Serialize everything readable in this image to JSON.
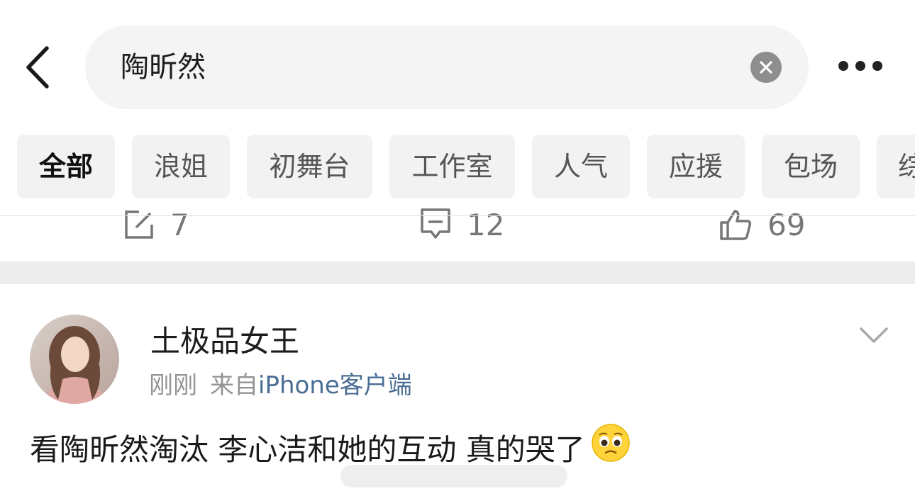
{
  "search": {
    "query": "陶昕然"
  },
  "tabs": [
    {
      "label": "全部",
      "active": true
    },
    {
      "label": "浪姐"
    },
    {
      "label": "初舞台"
    },
    {
      "label": "工作室"
    },
    {
      "label": "人气"
    },
    {
      "label": "应援"
    },
    {
      "label": "包场"
    },
    {
      "label": "综"
    }
  ],
  "prev_post_actions": {
    "repost_count": "7",
    "comment_count": "12",
    "like_count": "69"
  },
  "post": {
    "username": "土极品女王",
    "time": "刚刚",
    "source_prefix": "来自",
    "client": "iPhone客户端",
    "text": "看陶昕然淘汰 李心洁和她的互动 真的哭了",
    "emoji": "pleading-face-icon"
  },
  "colors": {
    "link_blue": "#4a6d94",
    "meta_gray": "#949494",
    "tab_bg": "#f2f2f2",
    "search_bg": "#f4f4f4"
  }
}
